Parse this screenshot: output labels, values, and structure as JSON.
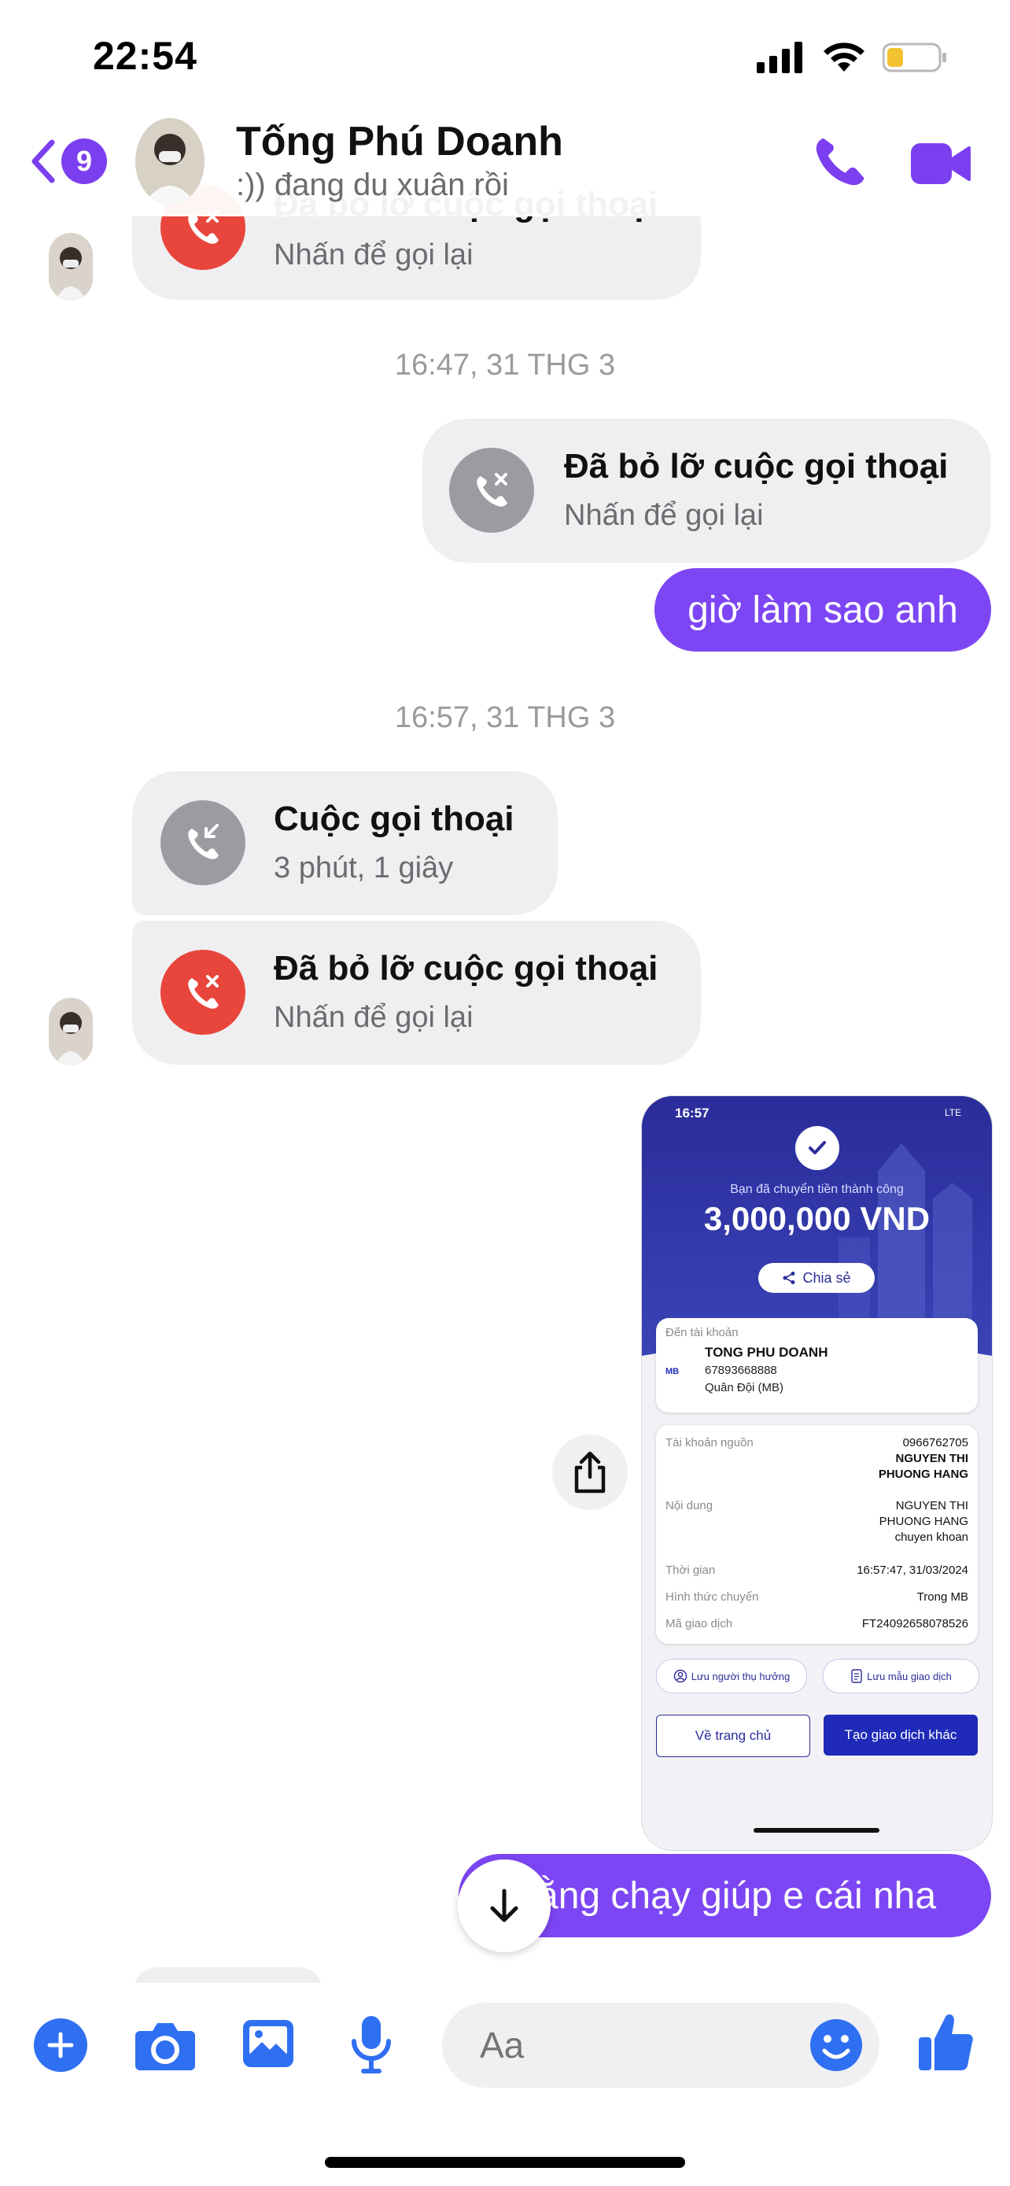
{
  "status_bar": {
    "time": "22:54"
  },
  "header": {
    "back_badge": "9",
    "contact_name": "Tống Phú Doanh",
    "contact_status": ":)) đang du xuân rồi"
  },
  "messages": {
    "top_partial": {
      "title": "Đã bỏ lỡ cuộc gọi thoại",
      "subtitle": "Nhấn để gọi lại"
    },
    "time1": "16:47, 31 THG 3",
    "missed_out": {
      "title": "Đã bỏ lỡ cuộc gọi thoại",
      "subtitle": "Nhấn để gọi lại"
    },
    "text_out1": "giờ làm sao anh",
    "time2": "16:57, 31 THG 3",
    "voice_call": {
      "title": "Cuộc gọi thoại",
      "subtitle": "3 phút, 1 giây"
    },
    "missed_in": {
      "title": "Đã bỏ lỡ cuộc gọi thoại",
      "subtitle": "Nhấn để gọi lại"
    },
    "text_out2": "ằng chạy giúp e cái nha"
  },
  "receipt": {
    "status_time": "16:57",
    "status_net": "LTE",
    "success_text": "Bạn đã chuyển tiền thành công",
    "amount": "3,000,000 VND",
    "share_label": "Chia sẻ",
    "to_label": "Đến tài khoản",
    "to_name": "TONG PHU DOANH",
    "to_account": "67893668888",
    "to_bank": "Quân Đội (MB)",
    "bank_logo": "MB",
    "rows": [
      {
        "label": "Tài khoản nguồn",
        "value": [
          "0966762705",
          "NGUYEN THI",
          "PHUONG HANG"
        ]
      },
      {
        "label": "Nội dung",
        "value": [
          "NGUYEN THI",
          "PHUONG HANG",
          "chuyen khoan"
        ]
      },
      {
        "label": "Thời gian",
        "value": [
          "16:57:47, 31/03/2024"
        ]
      },
      {
        "label": "Hình thức chuyển",
        "value": [
          "Trong MB"
        ]
      },
      {
        "label": "Mã giao dịch",
        "value": [
          "FT24092658078526"
        ]
      }
    ],
    "save_beneficiary": "Lưu người thụ hưởng",
    "save_template": "Lưu mẫu giao dịch",
    "home_btn": "Về trang chủ",
    "new_txn_btn": "Tạo giao dịch khác"
  },
  "composer": {
    "placeholder": "Aa"
  },
  "colors": {
    "accent": "#7d46f4",
    "missed": "#e8453c",
    "gray_icon": "#9b9ca1",
    "bank_blue": "#1f2ab8"
  },
  "icons": [
    "back-icon",
    "phone-icon",
    "video-icon",
    "missed-call-icon",
    "incoming-call-icon",
    "share-icon",
    "scroll-down-icon",
    "plus-icon",
    "camera-icon",
    "image-icon",
    "mic-icon",
    "emoji-icon",
    "like-icon"
  ]
}
